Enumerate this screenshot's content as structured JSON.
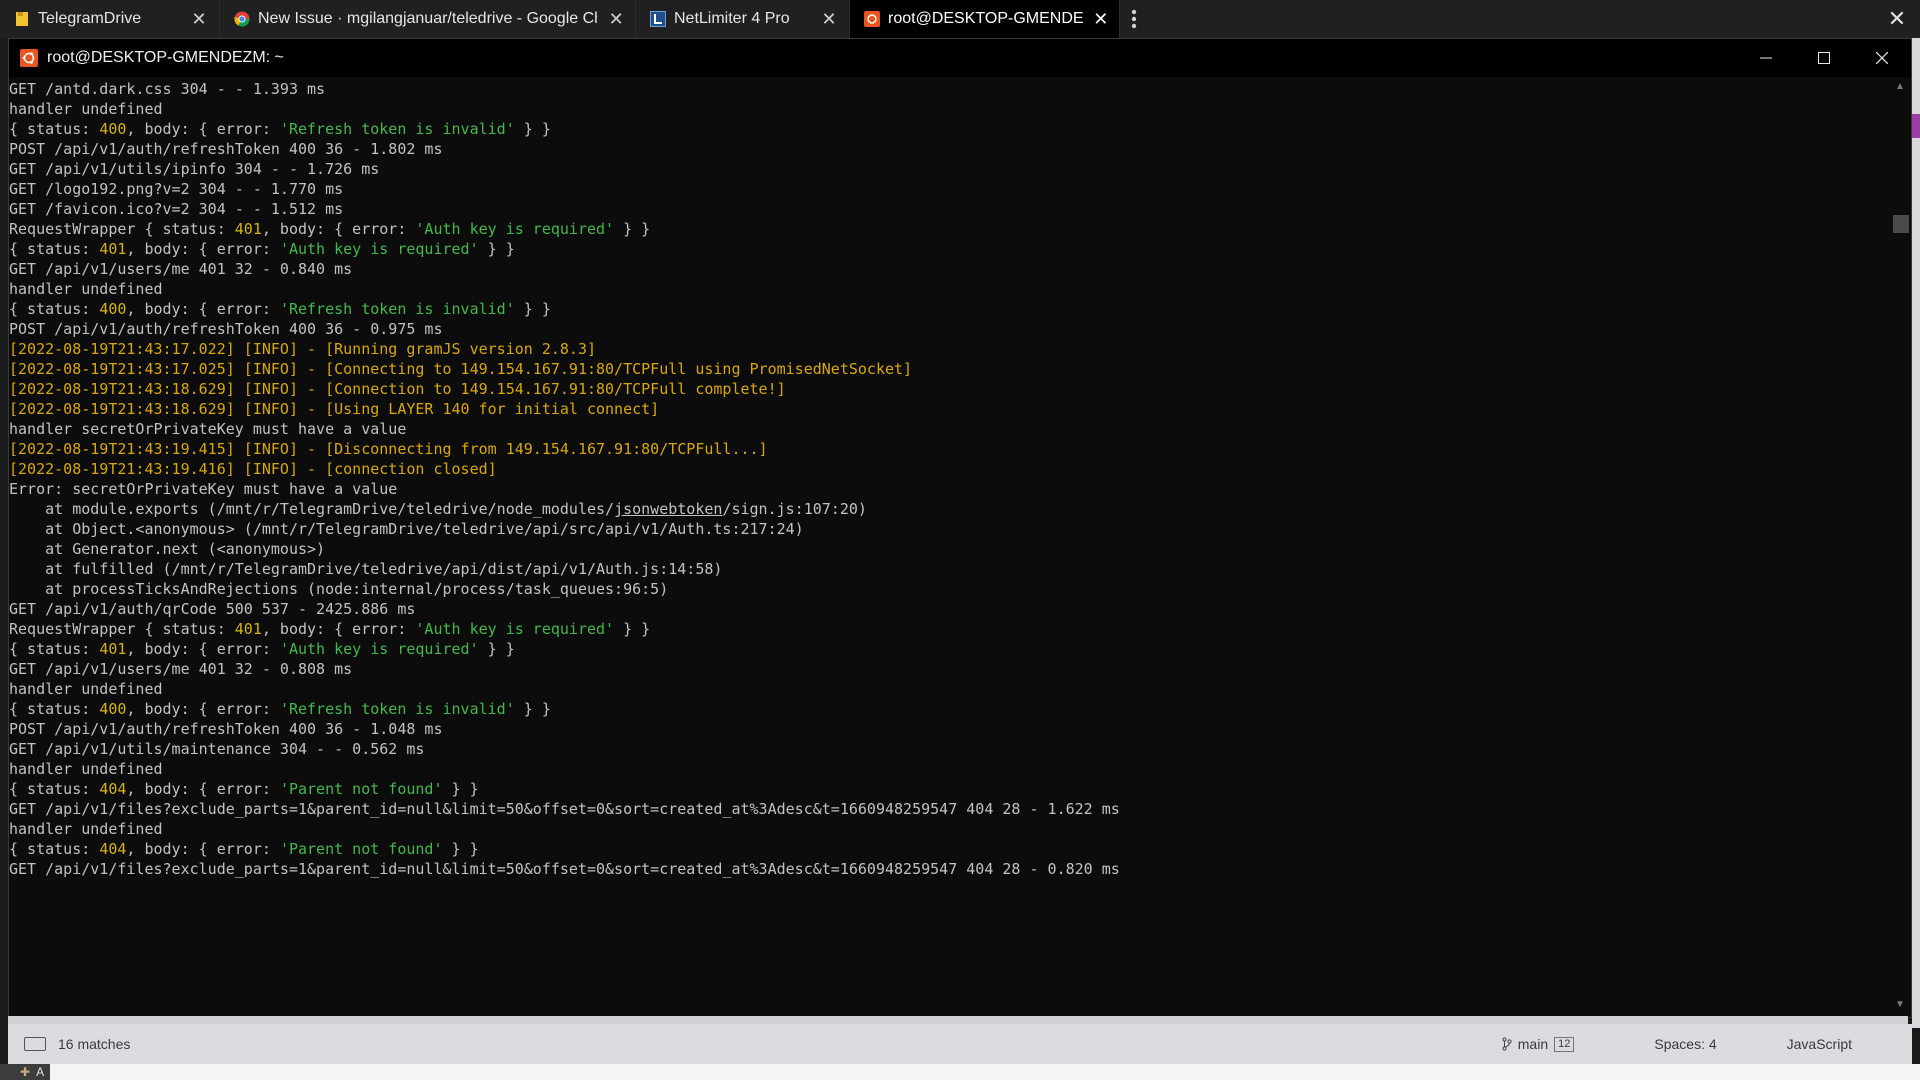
{
  "tabs": [
    {
      "label": "TelegramDrive",
      "icon": "folder-icon",
      "active": false
    },
    {
      "label": "New Issue · mgilangjanuar/teledrive - Google Chrome",
      "icon": "chrome-icon",
      "active": false
    },
    {
      "label": "NetLimiter 4 Pro",
      "icon": "netlimiter-icon",
      "active": false
    },
    {
      "label": "root@DESKTOP-GMENDEZM: ~",
      "icon": "terminal-app-icon",
      "active": true
    }
  ],
  "window": {
    "title": "root@DESKTOP-GMENDEZM: ~"
  },
  "terminal": {
    "lines": [
      "GET /antd.dark.css 304 - - 1.393 ms",
      "handler undefined",
      "{ status: 400, body: { error: 'Refresh token is invalid' } }",
      "POST /api/v1/auth/refreshToken 400 36 - 1.802 ms",
      "GET /api/v1/utils/ipinfo 304 - - 1.726 ms",
      "GET /logo192.png?v=2 304 - - 1.770 ms",
      "GET /favicon.ico?v=2 304 - - 1.512 ms",
      "RequestWrapper { status: 401, body: { error: 'Auth key is required' } }",
      "{ status: 401, body: { error: 'Auth key is required' } }",
      "GET /api/v1/users/me 401 32 - 0.840 ms",
      "handler undefined",
      "{ status: 400, body: { error: 'Refresh token is invalid' } }",
      "POST /api/v1/auth/refreshToken 400 36 - 0.975 ms",
      "[2022-08-19T21:43:17.022] [INFO] - [Running gramJS version 2.8.3]",
      "[2022-08-19T21:43:17.025] [INFO] - [Connecting to 149.154.167.91:80/TCPFull using PromisedNetSocket]",
      "[2022-08-19T21:43:18.629] [INFO] - [Connection to 149.154.167.91:80/TCPFull complete!]",
      "[2022-08-19T21:43:18.629] [INFO] - [Using LAYER 140 for initial connect]",
      "handler secretOrPrivateKey must have a value",
      "[2022-08-19T21:43:19.415] [INFO] - [Disconnecting from 149.154.167.91:80/TCPFull...]",
      "[2022-08-19T21:43:19.416] [INFO] - [connection closed]",
      "Error: secretOrPrivateKey must have a value",
      "    at module.exports (/mnt/r/TelegramDrive/teledrive/node_modules/jsonwebtoken/sign.js:107:20)",
      "    at Object.<anonymous> (/mnt/r/TelegramDrive/teledrive/api/src/api/v1/Auth.ts:217:24)",
      "    at Generator.next (<anonymous>)",
      "    at fulfilled (/mnt/r/TelegramDrive/teledrive/api/dist/api/v1/Auth.js:14:58)",
      "    at processTicksAndRejections (node:internal/process/task_queues:96:5)",
      "GET /api/v1/auth/qrCode 500 537 - 2425.886 ms",
      "RequestWrapper { status: 401, body: { error: 'Auth key is required' } }",
      "{ status: 401, body: { error: 'Auth key is required' } }",
      "GET /api/v1/users/me 401 32 - 0.808 ms",
      "handler undefined",
      "{ status: 400, body: { error: 'Refresh token is invalid' } }",
      "POST /api/v1/auth/refreshToken 400 36 - 1.048 ms",
      "GET /api/v1/utils/maintenance 304 - - 0.562 ms",
      "handler undefined",
      "{ status: 404, body: { error: 'Parent not found' } }",
      "GET /api/v1/files?exclude_parts=1&parent_id=null&limit=50&offset=0&sort=created_at%3Adesc&t=1660948259547 404 28 - 1.622 ms",
      "handler undefined",
      "{ status: 404, body: { error: 'Parent not found' } }",
      "GET /api/v1/files?exclude_parts=1&parent_id=null&limit=50&offset=0&sort=created_at%3Adesc&t=1660948259547 404 28 - 0.820 ms"
    ]
  },
  "statusbar": {
    "matches": "16 matches",
    "branch": "main",
    "branch_count": "12",
    "spaces": "Spaces: 4",
    "language": "JavaScript"
  },
  "bottom_tab_label": "A",
  "colors": {
    "number": "#d6b500",
    "string": "#43b84a",
    "info": "#d8a800",
    "default_text": "#c2c2c2"
  }
}
